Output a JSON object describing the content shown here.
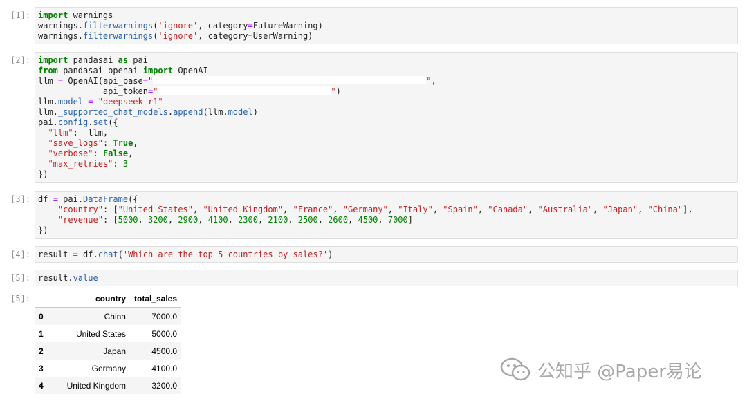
{
  "cells": [
    {
      "prompt": "[1]:",
      "lines": [
        "import warnings",
        "warnings.filterwarnings('ignore', category=FutureWarning)",
        "warnings.filterwarnings('ignore', category=UserWarning)"
      ]
    },
    {
      "prompt": "[2]:",
      "lines": [
        "import pandasai as pai",
        "from pandasai_openai import OpenAI",
        "llm = OpenAI(api_base=\"                                   \",",
        "             api_token=\"                                   \")",
        "llm.model = \"deepseek-r1\"",
        "llm._supported_chat_models.append(llm.model)",
        "pai.config.set({",
        "  \"llm\":  llm,",
        "  \"save_logs\": True,",
        "  \"verbose\": False,",
        "  \"max_retries\": 3",
        "})"
      ]
    },
    {
      "prompt": "[3]:",
      "lines": [
        "df = pai.DataFrame({",
        "    \"country\": [\"United States\", \"United Kingdom\", \"France\", \"Germany\", \"Italy\", \"Spain\", \"Canada\", \"Australia\", \"Japan\", \"China\"],",
        "    \"revenue\": [5000, 3200, 2900, 4100, 2300, 2100, 2500, 2600, 4500, 7000]",
        "})"
      ]
    },
    {
      "prompt": "[4]:",
      "lines": [
        "result = df.chat('Which are the top 5 countries by sales?')"
      ]
    },
    {
      "prompt": "[5]:",
      "lines": [
        "result.value"
      ]
    }
  ],
  "output": {
    "prompt": "[5]:",
    "columns": [
      "",
      "country",
      "total_sales"
    ],
    "rows": [
      [
        "0",
        "China",
        "7000.0"
      ],
      [
        "1",
        "United States",
        "5000.0"
      ],
      [
        "2",
        "Japan",
        "4500.0"
      ],
      [
        "3",
        "Germany",
        "4100.0"
      ],
      [
        "4",
        "United Kingdom",
        "3200.0"
      ]
    ]
  },
  "watermark": {
    "text": "公知乎 @Paper易论",
    "logo_icon": "wechat-logo-icon"
  }
}
